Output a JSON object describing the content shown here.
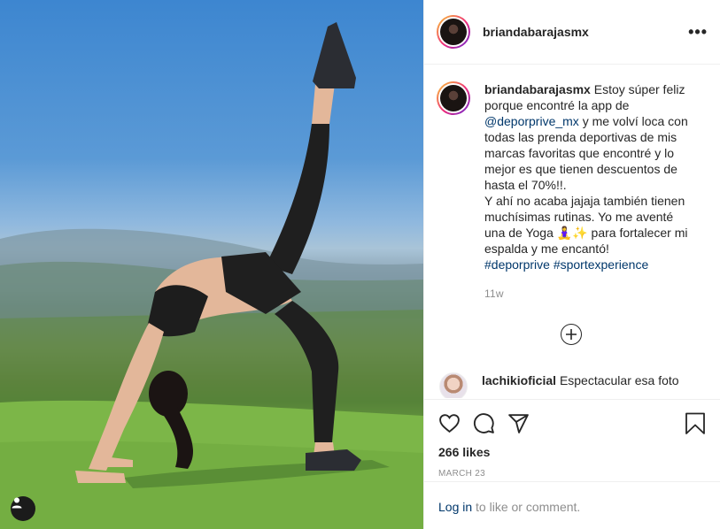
{
  "post": {
    "username": "briandabarajasmx",
    "caption": {
      "username": "briandabarajasmx",
      "line1": "Estoy súper feliz porque encontré la app de",
      "mention": "@deporprive_mx",
      "line2": "y me volví loca con todas las prenda deportivas de mis marcas favoritas que encontré y lo mejor es que tienen descuentos de hasta el 70%!!.",
      "line3": "Y ahí no acaba jajaja también tienen muchísimas rutinas. Yo me aventé una de Yoga",
      "yoga_emojis": "🧘‍♀️✨",
      "line4": "para fortalecer mi espalda y me encantó!",
      "hashtag1": "#deporprive",
      "hashtag2": "#sportexperience"
    },
    "time": "11w",
    "more_label": "•••",
    "comment": {
      "username": "lachikioficial",
      "text": "Espectacular esa foto"
    },
    "likes": "266 likes",
    "date": "MARCH 23",
    "login_link": "Log in",
    "login_rest": "to like or comment."
  },
  "icons": {
    "more": "more-options-icon",
    "load_more": "plus-circle-icon",
    "like": "heart-icon",
    "comment": "comment-icon",
    "share": "paper-plane-icon",
    "save": "bookmark-icon",
    "user_tag": "user-tag-icon"
  },
  "colors": {
    "link": "#00376b",
    "secondary_text": "#8e8e8e",
    "border": "#efefef"
  }
}
